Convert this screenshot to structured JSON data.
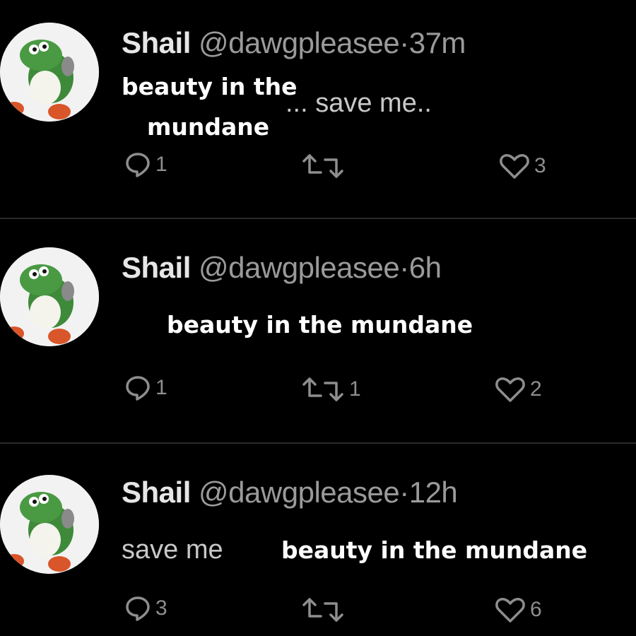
{
  "theme": {
    "background": "#000000",
    "text": "#e6e6e6",
    "muted": "#9a9a9a",
    "sticker_text": "#ffffff",
    "divider": "#2a2a2a"
  },
  "tweets": [
    {
      "name": "Shail",
      "handle": "@dawgpleasee",
      "separator": "·",
      "time": "37m",
      "body": "... save me..",
      "sticker": "beauty in the",
      "sticker_line2": "mundane",
      "replies": "1",
      "retweets": "",
      "likes": "3",
      "icons": {
        "avatar": "yoshi-avatar",
        "reply": "reply-icon",
        "retweet": "retweet-icon",
        "like": "heart-icon"
      }
    },
    {
      "name": "Shail",
      "handle": "@dawgpleasee",
      "separator": "·",
      "time": "6h",
      "body": "",
      "sticker": "beauty in the mundane",
      "replies": "1",
      "retweets": "1",
      "likes": "2",
      "icons": {
        "avatar": "yoshi-avatar",
        "reply": "reply-icon",
        "retweet": "retweet-icon",
        "like": "heart-icon"
      }
    },
    {
      "name": "Shail",
      "handle": "@dawgpleasee",
      "separator": "·",
      "time": "12h",
      "body": "save me",
      "sticker": "beauty in the mundane",
      "replies": "3",
      "retweets": "",
      "likes": "6",
      "icons": {
        "avatar": "yoshi-avatar",
        "reply": "reply-icon",
        "retweet": "retweet-icon",
        "like": "heart-icon"
      }
    }
  ]
}
